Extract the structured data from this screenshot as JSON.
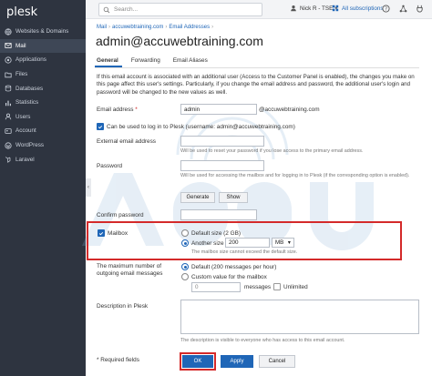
{
  "app": {
    "logo": "plesk"
  },
  "sidebar": {
    "items": [
      {
        "label": "Websites & Domains",
        "icon": "globe-icon"
      },
      {
        "label": "Mail",
        "icon": "envelope-icon",
        "active": true
      },
      {
        "label": "Applications",
        "icon": "apps-icon"
      },
      {
        "label": "Files",
        "icon": "folder-icon"
      },
      {
        "label": "Databases",
        "icon": "database-icon"
      },
      {
        "label": "Statistics",
        "icon": "bar-chart-icon"
      },
      {
        "label": "Users",
        "icon": "user-icon"
      },
      {
        "label": "Account",
        "icon": "id-card-icon"
      },
      {
        "label": "WordPress",
        "icon": "wordpress-icon"
      },
      {
        "label": "Laravel",
        "icon": "laravel-icon"
      }
    ]
  },
  "topbar": {
    "search_placeholder": "Search...",
    "user": "Nick R - TSE",
    "subscriptions": "All subscriptions"
  },
  "breadcrumb": [
    "Mail",
    "accuwebtraining.com",
    "Email Addresses"
  ],
  "page_title": "admin@accuwebtraining.com",
  "tabs": [
    "General",
    "Forwarding",
    "Email Aliases"
  ],
  "intro": "If this email account is associated with an additional user (Access to the Customer Panel is enabled), the changes you make on this page affect this user's settings. Particularly, if you change the email address and password, the additional user's login and password will be changed to the new values as well.",
  "form": {
    "email_label": "Email address",
    "required_mark": "*",
    "email_value": "admin",
    "email_domain": "@accuwebtraining.com",
    "login_checkbox_label": "Can be used to log in to Plesk  (username: admin@accuwebtraining.com)",
    "external_label": "External email address",
    "external_hint": "Will be used to reset your password if you lose access to the primary email address.",
    "password_label": "Password",
    "password_hint": "Will be used for accessing the mailbox and for logging in to Plesk (if the corresponding option is enabled).",
    "generate_label": "Generate",
    "show_label": "Show",
    "confirm_label": "Confirm password",
    "mailbox_label": "Mailbox",
    "default_size_label": "Default size (2 GB)",
    "another_size_label": "Another size",
    "size_value": "200",
    "size_unit": "MB",
    "mailbox_hint": "The mailbox size cannot exceed the default size.",
    "max_messages_label": "The maximum number of outgoing email messages",
    "default_messages_label": "Default (200 messages per hour)",
    "custom_messages_label": "Custom value for the mailbox",
    "messages_value": "0",
    "messages_word": "messages",
    "unlimited_label": "Unlimited",
    "description_label": "Description in Plesk",
    "description_hint": "The description is visible to everyone who has access to this email account.",
    "required_fields_note": "* Required fields"
  },
  "buttons": {
    "ok": "OK",
    "apply": "Apply",
    "cancel": "Cancel"
  },
  "colors": {
    "accent": "#1f66b7",
    "sidebar": "#2e3440",
    "highlight": "#d42a2a"
  }
}
